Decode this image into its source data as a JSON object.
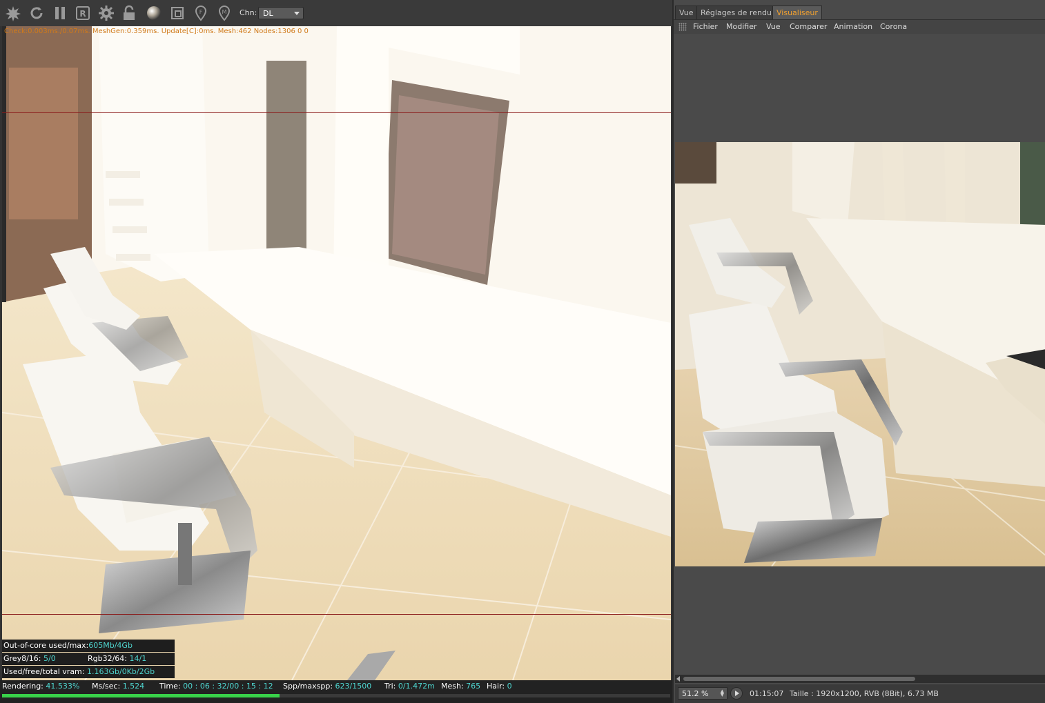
{
  "toolbar": {
    "icons": [
      "burst-icon",
      "refresh-icon",
      "pause-icon",
      "region-icon",
      "settings-icon",
      "lock-icon",
      "material-sphere-icon",
      "crop-icon",
      "focus-pin-icon",
      "material-pin-icon"
    ],
    "chn_label": "Chn:",
    "chn_value": "DL"
  },
  "render": {
    "stats_line": "Check:0.003ms./0.07ms. MeshGen:0.359ms. Update[C]:0ms. Mesh:462 Nodes:1306  0 0"
  },
  "memory": {
    "ooc_label": "Out-of-core used/max:",
    "ooc_value": "605Mb/4Gb",
    "grey_label": "Grey8/16:",
    "grey_value": "5/0",
    "rgb_label": "Rgb32/64:",
    "rgb_value": "14/1",
    "vram_label": "Used/free/total vram:",
    "vram_value": "1.163Gb/0Kb/2Gb"
  },
  "status": {
    "rendering_label": "Rendering:",
    "rendering_value": "41.533%",
    "progress": 0.41533,
    "mssec_label": "Ms/sec:",
    "mssec_value": "1.524",
    "time_label": "Time:",
    "time_value": "00 : 06 : 32/00 : 15 : 12",
    "spp_label": "Spp/maxspp:",
    "spp_value": "623/1500",
    "tri_label": "Tri:",
    "tri_value": "0/1.472m",
    "mesh_label": "Mesh:",
    "mesh_value": "765",
    "hair_label": "Hair:",
    "hair_value": "0"
  },
  "tabs": [
    {
      "label": "Vue",
      "active": false
    },
    {
      "label": "Réglages de rendu",
      "active": false
    },
    {
      "label": "Visualiseur",
      "active": true
    }
  ],
  "menu": [
    "Fichier",
    "Modifier",
    "Vue",
    "Comparer",
    "Animation",
    "Corona"
  ],
  "viewer": {
    "zoom": "51.2 %",
    "render_time": "01:15:07",
    "info": "Taille : 1920x1200, RVB (8Bit), 6.73 MB"
  },
  "colors": {
    "accent_tab": "#f0a030",
    "stat_value": "#4fd6d0",
    "progress": "#39d24a",
    "region_line": "#8a1a1a"
  }
}
